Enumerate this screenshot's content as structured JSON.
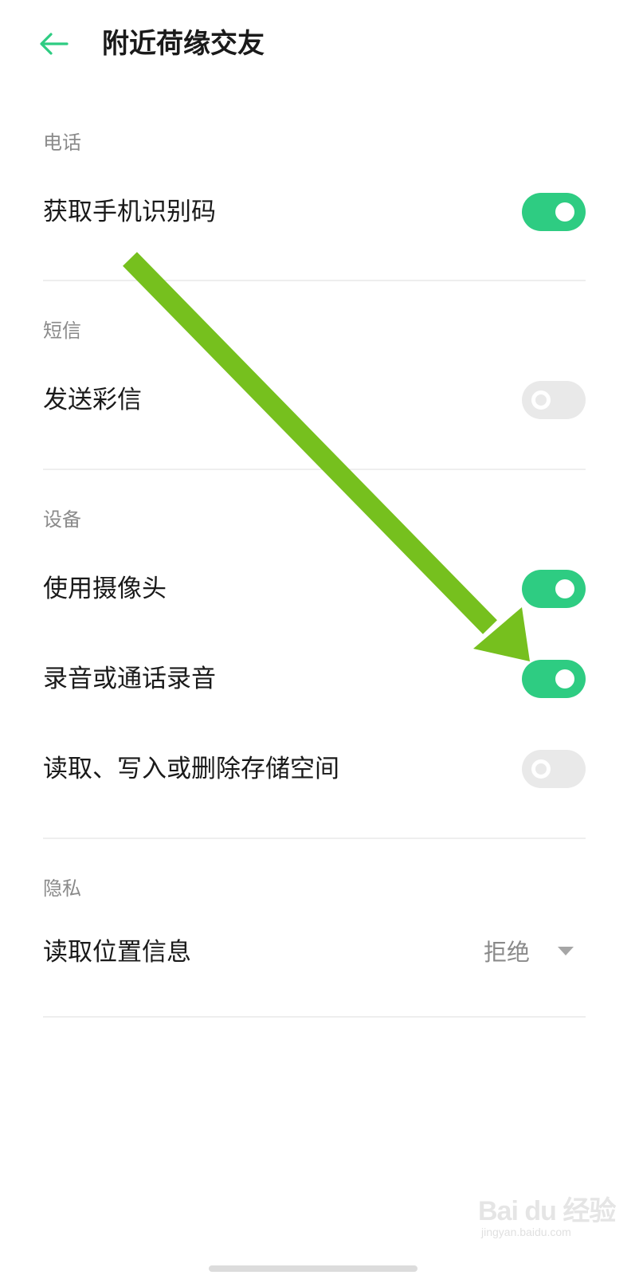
{
  "header": {
    "back_icon": "arrow-left-icon",
    "title": "附近荷缘交友",
    "accent_color": "#2ecc82"
  },
  "sections": {
    "phone": {
      "header": "电话",
      "items": [
        {
          "label": "获取手机识别码",
          "enabled": true
        }
      ]
    },
    "sms": {
      "header": "短信",
      "items": [
        {
          "label": "发送彩信",
          "enabled": false
        }
      ]
    },
    "device": {
      "header": "设备",
      "items": [
        {
          "label": "使用摄像头",
          "enabled": true
        },
        {
          "label": "录音或通话录音",
          "enabled": true
        },
        {
          "label": "读取、写入或删除存储空间",
          "enabled": false
        }
      ]
    },
    "privacy": {
      "header": "隐私",
      "items": [
        {
          "label": "读取位置信息",
          "value": "拒绝"
        }
      ]
    }
  },
  "annotation": {
    "arrow_color": "#76c01e"
  },
  "watermark": {
    "logo": "Bai du 经验",
    "url": "jingyan.baidu.com"
  }
}
